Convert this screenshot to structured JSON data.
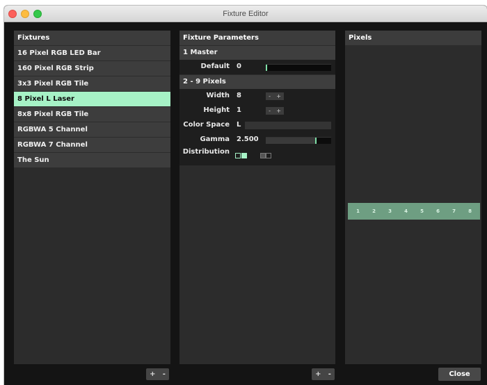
{
  "window": {
    "title": "Fixture Editor"
  },
  "fixtures": {
    "header": "Fixtures",
    "items": [
      "16 Pixel RGB LED Bar",
      "160 Pixel RGB Strip",
      "3x3 Pixel RGB Tile",
      "8 Pixel L Laser",
      "8x8 Pixel RGB Tile",
      "RGBWA 5 Channel",
      "RGBWA 7 Channel",
      "The Sun"
    ],
    "selected_index": 3,
    "add_label": "+",
    "remove_label": "-"
  },
  "params": {
    "header": "Fixture Parameters",
    "master": {
      "title": "1   Master",
      "default_label": "Default",
      "default_value": "0",
      "default_level": 0
    },
    "pixels": {
      "title": "2 - 9   Pixels",
      "width_label": "Width",
      "width_value": "8",
      "height_label": "Height",
      "height_value": "1",
      "stepper_minus": "-",
      "stepper_plus": "+",
      "color_space_label": "Color Space",
      "color_space_value": "L",
      "gamma_label": "Gamma",
      "gamma_value": "2.500",
      "gamma_level": 0.75,
      "distribution_label": "Distribution"
    },
    "add_label": "+",
    "remove_label": "-"
  },
  "pixels_panel": {
    "header": "Pixels",
    "cells": [
      "1",
      "2",
      "3",
      "4",
      "5",
      "6",
      "7",
      "8"
    ]
  },
  "footer": {
    "close_label": "Close"
  },
  "colors": {
    "selection": "#a6f2c6",
    "pixel_strip": "#6e9e82",
    "panel_bg": "#2c2c2c",
    "header_bg": "#3c3c3c"
  }
}
